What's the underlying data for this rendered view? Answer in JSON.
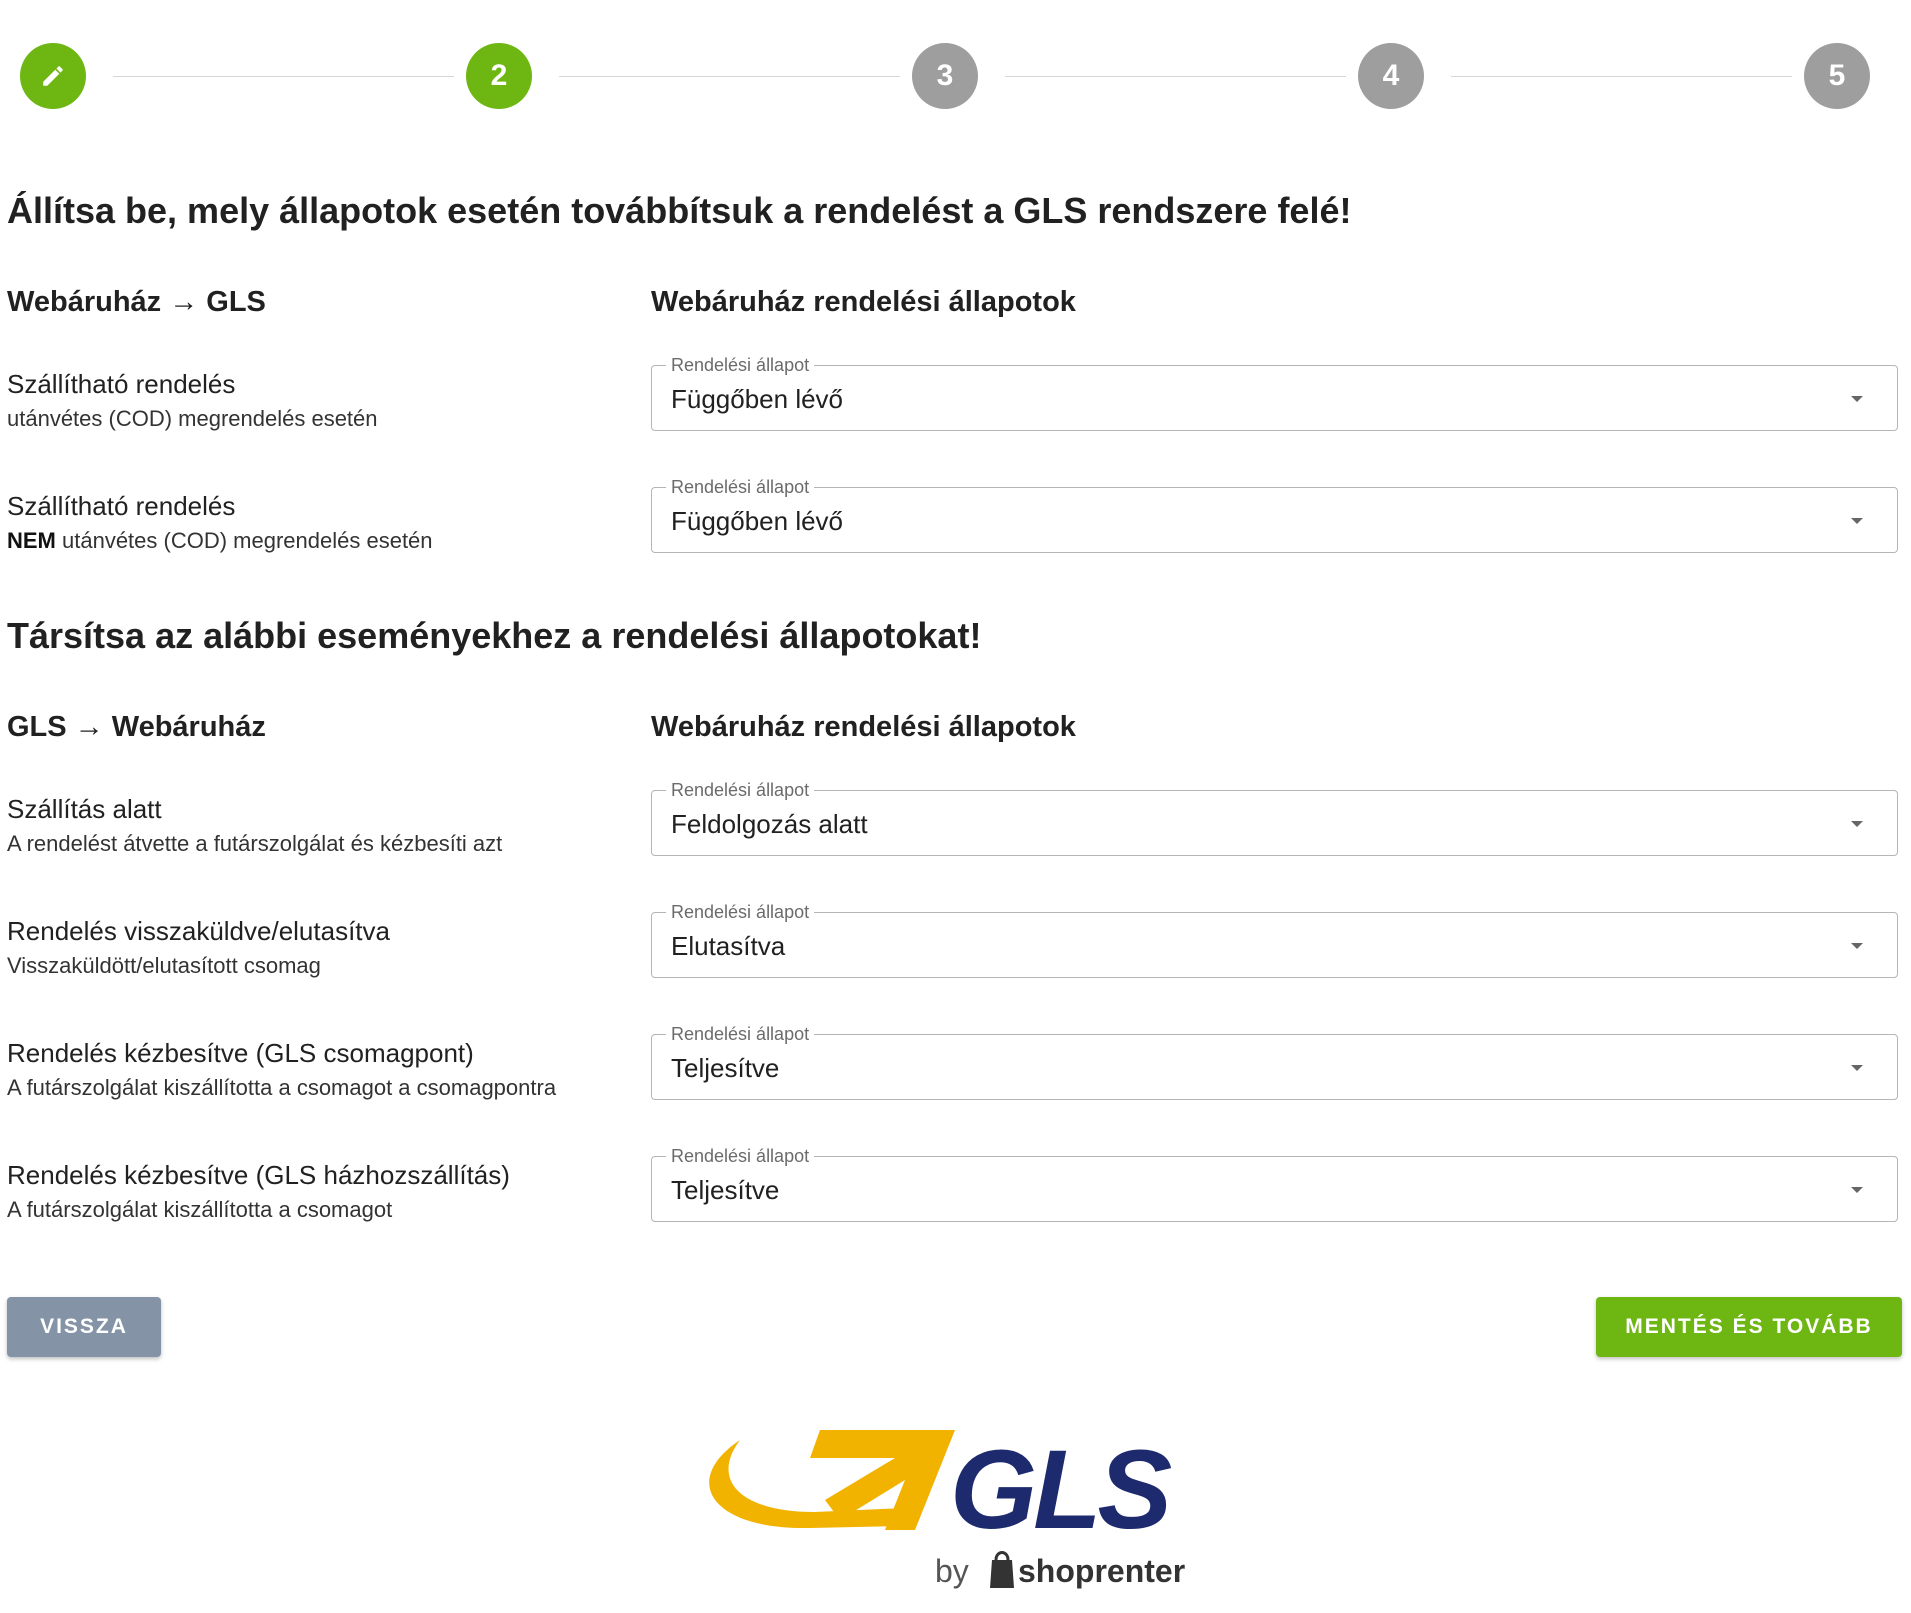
{
  "stepper": {
    "steps": [
      {
        "label": "",
        "state": "done"
      },
      {
        "label": "2",
        "state": "active"
      },
      {
        "label": "3",
        "state": "todo"
      },
      {
        "label": "4",
        "state": "todo"
      },
      {
        "label": "5",
        "state": "todo"
      }
    ],
    "edit_icon": "pencil-icon"
  },
  "section1": {
    "title": "Állítsa be, mely állapotok esetén továbbítsuk a rendelést a GLS rendszere felé!",
    "left_header": "Webáruház → GLS",
    "right_header": "Webáruház rendelési állapotok",
    "rows": [
      {
        "title": "Szállítható rendelés",
        "desc_bold": "",
        "desc": "utánvétes (COD) megrendelés esetén",
        "select_label": "Rendelési állapot",
        "select_value": "Függőben lévő"
      },
      {
        "title": "Szállítható rendelés",
        "desc_bold": "NEM",
        "desc": " utánvétes (COD) megrendelés esetén",
        "select_label": "Rendelési állapot",
        "select_value": "Függőben lévő"
      }
    ]
  },
  "section2": {
    "title": "Társítsa az alábbi eseményekhez a rendelési állapotokat!",
    "left_header": "GLS → Webáruház",
    "right_header": "Webáruház rendelési állapotok",
    "rows": [
      {
        "title": "Szállítás alatt",
        "desc": "A rendelést átvette a futárszolgálat és kézbesíti azt",
        "select_label": "Rendelési állapot",
        "select_value": "Feldolgozás alatt"
      },
      {
        "title": "Rendelés visszaküldve/elutasítva",
        "desc": "Visszaküldött/elutasított csomag",
        "select_label": "Rendelési állapot",
        "select_value": "Elutasítva"
      },
      {
        "title": "Rendelés kézbesítve (GLS csomagpont)",
        "desc": "A futárszolgálat kiszállította a csomagot a csomagpontra",
        "select_label": "Rendelési állapot",
        "select_value": "Teljesítve"
      },
      {
        "title": "Rendelés kézbesítve (GLS házhozszállítás)",
        "desc": "A futárszolgálat kiszállította a csomagot",
        "select_label": "Rendelési állapot",
        "select_value": "Teljesítve"
      }
    ]
  },
  "buttons": {
    "back": "VISSZA",
    "next": "MENTÉS ÉS TOVÁBB"
  },
  "colors": {
    "accent_green": "#6eb713",
    "step_grey": "#9e9e9e",
    "back_button": "#8494a6",
    "gls_blue": "#1e2a6e",
    "gls_yellow": "#f2b200"
  },
  "logo": {
    "brand": "GLS",
    "by": "by",
    "partner": "shoprenter"
  }
}
